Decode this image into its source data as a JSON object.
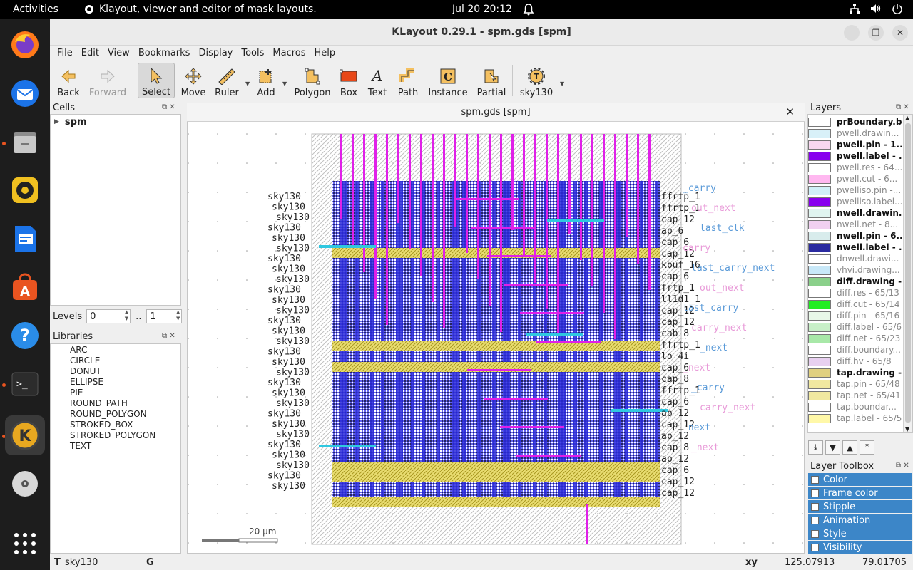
{
  "topbar": {
    "activities": "Activities",
    "app_name": "Klayout, viewer and editor of mask layouts.",
    "clock": "Jul 20  20:12"
  },
  "window": {
    "title": "KLayout 0.29.1 - spm.gds [spm]",
    "minimize": "—",
    "maximize": "❐",
    "close": "✕"
  },
  "menu": [
    "File",
    "Edit",
    "View",
    "Bookmarks",
    "Display",
    "Tools",
    "Macros",
    "Help"
  ],
  "toolbar": {
    "back": "Back",
    "forward": "Forward",
    "select": "Select",
    "move": "Move",
    "ruler": "Ruler",
    "add": "Add",
    "polygon": "Polygon",
    "box": "Box",
    "text": "Text",
    "path": "Path",
    "instance": "Instance",
    "partial": "Partial",
    "tech": "sky130"
  },
  "cells": {
    "title": "Cells",
    "root": "spm"
  },
  "levels": {
    "label": "Levels",
    "from": "0",
    "sep": "..",
    "to": "1"
  },
  "libraries": {
    "title": "Libraries",
    "items": [
      "ARC",
      "CIRCLE",
      "DONUT",
      "ELLIPSE",
      "PIE",
      "ROUND_PATH",
      "ROUND_POLYGON",
      "STROKED_BOX",
      "STROKED_POLYGON",
      "TEXT"
    ]
  },
  "view": {
    "tab_title": "spm.gds [spm]",
    "scale_label": "20 µm",
    "cell_labels_left": [
      "sky130",
      "sky130",
      "sky130",
      "sky130",
      "sky130",
      "sky130",
      "sky130",
      "sky130",
      "sky130",
      "sky130",
      "sky130",
      "sky130",
      "sky130",
      "sky130",
      "sky130",
      "sky130",
      "sky130",
      "sky130",
      "sky130",
      "sky130",
      "sky130",
      "sky130",
      "sky130",
      "sky130",
      "sky130",
      "sky130",
      "sky130",
      "sky130",
      "sky130"
    ],
    "cell_labels_right": [
      "ffrtp_1",
      "ffrtp_1",
      "cap_12",
      "ap_6",
      "cap_6",
      "cap_12",
      "kbuf_16",
      "cap_6",
      "frtp_1",
      "ll1d1_1",
      "cap_12",
      "cap_12",
      "cab_8",
      "ffrtp_1",
      "lo_4i",
      "cap_6",
      "cap_8",
      "ffrtp_1",
      "cap_6",
      "ap_12",
      "cap_12",
      "ap_12",
      "cap_8",
      "ap_12",
      "cap_6",
      "cap_12",
      "cap_12"
    ],
    "net_labels": [
      "_carry",
      "out_next",
      "last_clk",
      "carry",
      "last_carry_next",
      "out_next",
      "last_carry",
      "carry_next",
      "_next",
      "_next",
      "_carry",
      "carry_next",
      "_next",
      "_next"
    ],
    "colors": {
      "boundary": "#bdbdbd",
      "metal_blue": "#2a2ad8",
      "metal_magenta": "#e020e8",
      "poly_yellow": "#d4c020",
      "cyan": "#30c8e0",
      "label_blue": "#5a9ad8",
      "label_pink": "#e89ad8"
    }
  },
  "layers": {
    "title": "Layers",
    "items": [
      {
        "name": "prBoundary.b...",
        "color": "#ffffff",
        "bold": true
      },
      {
        "name": "pwell.drawin...",
        "color": "#d8f0f8",
        "bold": false
      },
      {
        "name": "pwell.pin - 1...",
        "color": "#f8d8f0",
        "bold": true
      },
      {
        "name": "pwell.label - ...",
        "color": "#8800ee",
        "bold": true
      },
      {
        "name": "pwell.res - 64...",
        "color": "#ffffff",
        "bold": false
      },
      {
        "name": "pwell.cut - 6...",
        "color": "#ffb8f0",
        "bold": false
      },
      {
        "name": "pwelliso.pin -...",
        "color": "#d0f0f8",
        "bold": false
      },
      {
        "name": "pwelliso.label...",
        "color": "#8800ee",
        "bold": false
      },
      {
        "name": "nwell.drawin...",
        "color": "#e0f4f0",
        "bold": true
      },
      {
        "name": "nwell.net - 8...",
        "color": "#f0d0f0",
        "bold": false
      },
      {
        "name": "nwell.pin - 6...",
        "color": "#d8ecec",
        "bold": true
      },
      {
        "name": "nwell.label - ...",
        "color": "#2a2aa0",
        "bold": true
      },
      {
        "name": "dnwell.drawi...",
        "color": "#ffffff",
        "bold": false
      },
      {
        "name": "vhvi.drawing...",
        "color": "#c8e8f8",
        "bold": false
      },
      {
        "name": "diff.drawing -...",
        "color": "#8ad08a",
        "bold": true
      },
      {
        "name": "diff.res - 65/13",
        "color": "#ffffff",
        "bold": false
      },
      {
        "name": "diff.cut - 65/14",
        "color": "#22ee22",
        "bold": false
      },
      {
        "name": "diff.pin - 65/16",
        "color": "#e8f8e8",
        "bold": false
      },
      {
        "name": "diff.label - 65/6",
        "color": "#c8f0c8",
        "bold": false
      },
      {
        "name": "diff.net - 65/23",
        "color": "#a8e8a8",
        "bold": false
      },
      {
        "name": "diff.boundary...",
        "color": "#ffffff",
        "bold": false
      },
      {
        "name": "diff.hv - 65/8",
        "color": "#e8d0f0",
        "bold": false
      },
      {
        "name": "tap.drawing -...",
        "color": "#e0d080",
        "bold": true
      },
      {
        "name": "tap.pin - 65/48",
        "color": "#f0e8a0",
        "bold": false
      },
      {
        "name": "tap.net - 65/41",
        "color": "#f0e8a0",
        "bold": false
      },
      {
        "name": "tap.boundar...",
        "color": "#ffffff",
        "bold": false
      },
      {
        "name": "tap.label - 65/5",
        "color": "#fff8a8",
        "bold": false
      }
    ]
  },
  "layer_toolbox": {
    "title": "Layer Toolbox",
    "items": [
      "Color",
      "Frame color",
      "Stipple",
      "Animation",
      "Style",
      "Visibility"
    ]
  },
  "status": {
    "tech": "sky130",
    "grid": "G",
    "xy_label": "xy",
    "x": "125.07913",
    "y": "79.01705"
  }
}
